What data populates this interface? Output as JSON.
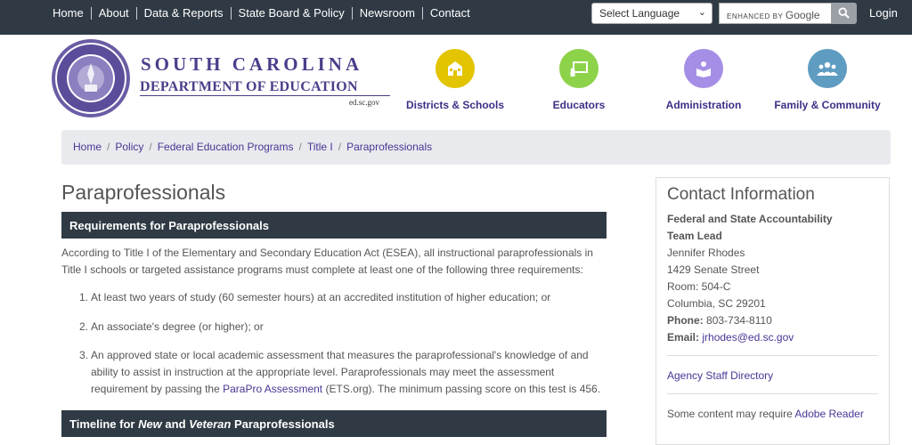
{
  "topnav": {
    "links": [
      "Home",
      "About",
      "Data & Reports",
      "State Board & Policy",
      "Newsroom",
      "Contact"
    ],
    "language_select": "Select Language",
    "search_brand_prefix": "ENHANCED BY",
    "search_brand": "Google",
    "login": "Login"
  },
  "brand": {
    "line1": "SOUTH CAROLINA",
    "line2": "DEPARTMENT OF EDUCATION",
    "domain": "ed.sc.gov"
  },
  "mainnav": [
    {
      "label": "Districts & Schools",
      "icon": "school-icon",
      "color": "#e2c400"
    },
    {
      "label": "Educators",
      "icon": "presentation-icon",
      "color": "#8dd34a"
    },
    {
      "label": "Administration",
      "icon": "reader-icon",
      "color": "#a58ee6"
    },
    {
      "label": "Family & Community",
      "icon": "people-icon",
      "color": "#5f9cc2"
    }
  ],
  "breadcrumb": [
    "Home",
    "Policy",
    "Federal Education Programs",
    "Title I",
    "Paraprofessionals"
  ],
  "main": {
    "title": "Paraprofessionals",
    "section1_title": "Requirements for Paraprofessionals",
    "intro": "According to Title I of the Elementary and Secondary Education Act (ESEA), all instructional paraprofessionals in Title I schools or targeted assistance programs must complete at least one of the following three requirements:",
    "requirements": [
      {
        "num": "1.",
        "text": "At least two years of study (60 semester hours) at an accredited institution of higher education; or"
      },
      {
        "num": "2.",
        "text": "An associate's degree (or higher); or"
      },
      {
        "num": "3.",
        "text_before": "An approved state or local academic assessment that measures the paraprofessional's knowledge of and ability to assist in instruction at the appropriate level. Paraprofessionals may meet the assessment requirement by passing the ",
        "link": "ParaPro Assessment",
        "text_after": " (ETS.org). The minimum passing score on this test is 456."
      }
    ],
    "section2_title_parts": [
      "Timeline for ",
      "New",
      " and ",
      "Veteran",
      " Paraprofessionals"
    ]
  },
  "contact": {
    "heading": "Contact Information",
    "office_line1": "Federal and State Accountability",
    "office_line2": "Team Lead",
    "name": "Jennifer Rhodes",
    "street": "1429 Senate Street",
    "room": "Room: 504-C",
    "city": "Columbia, SC 29201",
    "phone_label": "Phone:",
    "phone": "803-734-8110",
    "email_label": "Email:",
    "email": "jrhodes@ed.sc.gov",
    "directory": "Agency Staff Directory",
    "adobe_prefix": "Some content may require ",
    "adobe_link": "Adobe Reader"
  }
}
